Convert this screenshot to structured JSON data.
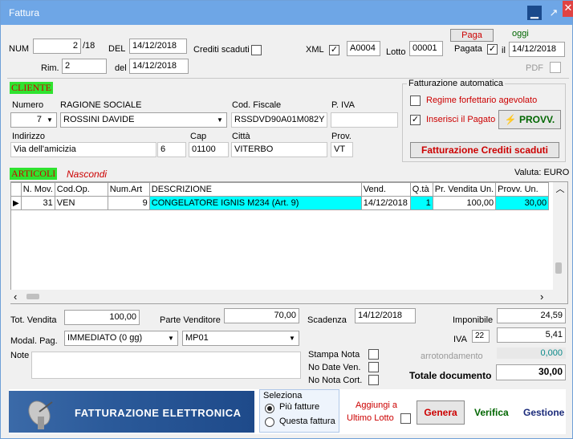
{
  "window": {
    "title": "Fattura"
  },
  "header": {
    "num_label": "NUM",
    "num_value": "2",
    "num_suffix": "/18",
    "del_label": "DEL",
    "del_value": "14/12/2018",
    "crediti_label": "Crediti scaduti",
    "xml_label": "XML",
    "xml_code": "A0004",
    "lotto_label": "Lotto",
    "lotto_value": "00001",
    "paga_button": "Paga",
    "oggi_label": "oggi",
    "pagata_label": "Pagata",
    "il_label": "il",
    "pagata_date": "14/12/2018",
    "rim_label": "Rim.",
    "rim_value": "2",
    "rim_del_label": "del",
    "rim_del_value": "14/12/2018",
    "pdf_label": "PDF"
  },
  "cliente": {
    "tag": "CLIENTE",
    "numero_label": "Numero",
    "numero_value": "7",
    "ragione_label": "RAGIONE SOCIALE",
    "ragione_value": "ROSSINI DAVIDE",
    "cf_label": "Cod. Fiscale",
    "cf_value": "RSSDVD90A01M082Y",
    "piva_label": "P. IVA",
    "piva_value": "",
    "indirizzo_label": "Indirizzo",
    "indirizzo_value": "Via dell'amicizia",
    "civico_value": "6",
    "cap_label": "Cap",
    "cap_value": "01100",
    "citta_label": "Città",
    "citta_value": "VITERBO",
    "prov_label": "Prov.",
    "prov_value": "VT"
  },
  "fatturazione_auto": {
    "title": "Fatturazione automatica",
    "regime_label": "Regime forfettario agevolato",
    "inserisci_label": "Inserisci il Pagato",
    "provv_button": "PROVV.",
    "crediti_button": "Fatturazione Crediti scaduti"
  },
  "articoli": {
    "tag": "ARTICOLI",
    "nascondi": "Nascondi",
    "valuta": "Valuta: EURO",
    "columns": [
      "N. Mov.",
      "Cod.Op.",
      "Num.Art",
      "DESCRIZIONE",
      "Vend.",
      "Q.tà",
      "Pr. Vendita Un.",
      "Provv. Un."
    ],
    "rows": [
      {
        "nmov": "31",
        "codop": "VEN",
        "numart": "9",
        "descr": "CONGELATORE IGNIS M234 (Art. 9)",
        "vend": "14/12/2018",
        "qta": "1",
        "prezzo": "100,00",
        "provv": "30,00"
      }
    ]
  },
  "totali": {
    "tot_vendita_label": "Tot. Vendita",
    "tot_vendita_value": "100,00",
    "parte_vend_label": "Parte Venditore",
    "parte_vend_value": "70,00",
    "scadenza_label": "Scadenza",
    "scadenza_value": "14/12/2018",
    "imponibile_label": "Imponibile",
    "imponibile_value": "24,59",
    "modal_label": "Modal. Pag.",
    "modal_value": "IMMEDIATO (0 gg)",
    "mp_value": "MP01",
    "iva_label": "IVA",
    "iva_rate": "22",
    "iva_value": "5,41",
    "note_label": "Note",
    "stampa_label": "Stampa Nota",
    "nodate_label": "No Date Ven.",
    "nonota_label": "No Nota Cort.",
    "arrot_label": "arrotondamento",
    "arrot_value": "0,000",
    "totale_label": "Totale documento",
    "totale_value": "30,00"
  },
  "footer": {
    "banner": "FATTURAZIONE ELETTRONICA",
    "seleziona_label": "Seleziona",
    "opt1": "Più fatture",
    "opt2": "Questa fattura",
    "aggiungi_label": "Aggiungi a",
    "ultimo_lotto": "Ultimo Lotto",
    "genera": "Genera",
    "verifica": "Verifica",
    "gestione": "Gestione"
  }
}
